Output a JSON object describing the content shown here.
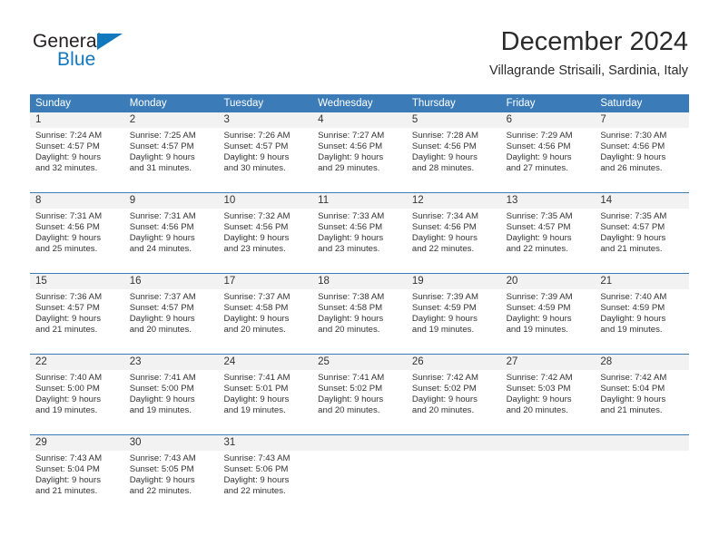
{
  "brand": {
    "name_part1": "General",
    "name_part2": "Blue",
    "triangle_icon": "blue-triangle-icon",
    "color_dark": "#231f20",
    "color_blue": "#1278be"
  },
  "header": {
    "title": "December 2024",
    "subtitle": "Villagrande Strisaili, Sardinia, Italy"
  },
  "theme": {
    "header_blue": "#3b7cb8",
    "daynum_band": "#f2f2f2",
    "text": "#333333"
  },
  "calendar": {
    "weekday_headers": [
      "Sunday",
      "Monday",
      "Tuesday",
      "Wednesday",
      "Thursday",
      "Friday",
      "Saturday"
    ],
    "weeks": [
      [
        {
          "day": "1",
          "sunrise": "Sunrise: 7:24 AM",
          "sunset": "Sunset: 4:57 PM",
          "daylight_line1": "Daylight: 9 hours",
          "daylight_line2": "and 32 minutes."
        },
        {
          "day": "2",
          "sunrise": "Sunrise: 7:25 AM",
          "sunset": "Sunset: 4:57 PM",
          "daylight_line1": "Daylight: 9 hours",
          "daylight_line2": "and 31 minutes."
        },
        {
          "day": "3",
          "sunrise": "Sunrise: 7:26 AM",
          "sunset": "Sunset: 4:57 PM",
          "daylight_line1": "Daylight: 9 hours",
          "daylight_line2": "and 30 minutes."
        },
        {
          "day": "4",
          "sunrise": "Sunrise: 7:27 AM",
          "sunset": "Sunset: 4:56 PM",
          "daylight_line1": "Daylight: 9 hours",
          "daylight_line2": "and 29 minutes."
        },
        {
          "day": "5",
          "sunrise": "Sunrise: 7:28 AM",
          "sunset": "Sunset: 4:56 PM",
          "daylight_line1": "Daylight: 9 hours",
          "daylight_line2": "and 28 minutes."
        },
        {
          "day": "6",
          "sunrise": "Sunrise: 7:29 AM",
          "sunset": "Sunset: 4:56 PM",
          "daylight_line1": "Daylight: 9 hours",
          "daylight_line2": "and 27 minutes."
        },
        {
          "day": "7",
          "sunrise": "Sunrise: 7:30 AM",
          "sunset": "Sunset: 4:56 PM",
          "daylight_line1": "Daylight: 9 hours",
          "daylight_line2": "and 26 minutes."
        }
      ],
      [
        {
          "day": "8",
          "sunrise": "Sunrise: 7:31 AM",
          "sunset": "Sunset: 4:56 PM",
          "daylight_line1": "Daylight: 9 hours",
          "daylight_line2": "and 25 minutes."
        },
        {
          "day": "9",
          "sunrise": "Sunrise: 7:31 AM",
          "sunset": "Sunset: 4:56 PM",
          "daylight_line1": "Daylight: 9 hours",
          "daylight_line2": "and 24 minutes."
        },
        {
          "day": "10",
          "sunrise": "Sunrise: 7:32 AM",
          "sunset": "Sunset: 4:56 PM",
          "daylight_line1": "Daylight: 9 hours",
          "daylight_line2": "and 23 minutes."
        },
        {
          "day": "11",
          "sunrise": "Sunrise: 7:33 AM",
          "sunset": "Sunset: 4:56 PM",
          "daylight_line1": "Daylight: 9 hours",
          "daylight_line2": "and 23 minutes."
        },
        {
          "day": "12",
          "sunrise": "Sunrise: 7:34 AM",
          "sunset": "Sunset: 4:56 PM",
          "daylight_line1": "Daylight: 9 hours",
          "daylight_line2": "and 22 minutes."
        },
        {
          "day": "13",
          "sunrise": "Sunrise: 7:35 AM",
          "sunset": "Sunset: 4:57 PM",
          "daylight_line1": "Daylight: 9 hours",
          "daylight_line2": "and 22 minutes."
        },
        {
          "day": "14",
          "sunrise": "Sunrise: 7:35 AM",
          "sunset": "Sunset: 4:57 PM",
          "daylight_line1": "Daylight: 9 hours",
          "daylight_line2": "and 21 minutes."
        }
      ],
      [
        {
          "day": "15",
          "sunrise": "Sunrise: 7:36 AM",
          "sunset": "Sunset: 4:57 PM",
          "daylight_line1": "Daylight: 9 hours",
          "daylight_line2": "and 21 minutes."
        },
        {
          "day": "16",
          "sunrise": "Sunrise: 7:37 AM",
          "sunset": "Sunset: 4:57 PM",
          "daylight_line1": "Daylight: 9 hours",
          "daylight_line2": "and 20 minutes."
        },
        {
          "day": "17",
          "sunrise": "Sunrise: 7:37 AM",
          "sunset": "Sunset: 4:58 PM",
          "daylight_line1": "Daylight: 9 hours",
          "daylight_line2": "and 20 minutes."
        },
        {
          "day": "18",
          "sunrise": "Sunrise: 7:38 AM",
          "sunset": "Sunset: 4:58 PM",
          "daylight_line1": "Daylight: 9 hours",
          "daylight_line2": "and 20 minutes."
        },
        {
          "day": "19",
          "sunrise": "Sunrise: 7:39 AM",
          "sunset": "Sunset: 4:59 PM",
          "daylight_line1": "Daylight: 9 hours",
          "daylight_line2": "and 19 minutes."
        },
        {
          "day": "20",
          "sunrise": "Sunrise: 7:39 AM",
          "sunset": "Sunset: 4:59 PM",
          "daylight_line1": "Daylight: 9 hours",
          "daylight_line2": "and 19 minutes."
        },
        {
          "day": "21",
          "sunrise": "Sunrise: 7:40 AM",
          "sunset": "Sunset: 4:59 PM",
          "daylight_line1": "Daylight: 9 hours",
          "daylight_line2": "and 19 minutes."
        }
      ],
      [
        {
          "day": "22",
          "sunrise": "Sunrise: 7:40 AM",
          "sunset": "Sunset: 5:00 PM",
          "daylight_line1": "Daylight: 9 hours",
          "daylight_line2": "and 19 minutes."
        },
        {
          "day": "23",
          "sunrise": "Sunrise: 7:41 AM",
          "sunset": "Sunset: 5:00 PM",
          "daylight_line1": "Daylight: 9 hours",
          "daylight_line2": "and 19 minutes."
        },
        {
          "day": "24",
          "sunrise": "Sunrise: 7:41 AM",
          "sunset": "Sunset: 5:01 PM",
          "daylight_line1": "Daylight: 9 hours",
          "daylight_line2": "and 19 minutes."
        },
        {
          "day": "25",
          "sunrise": "Sunrise: 7:41 AM",
          "sunset": "Sunset: 5:02 PM",
          "daylight_line1": "Daylight: 9 hours",
          "daylight_line2": "and 20 minutes."
        },
        {
          "day": "26",
          "sunrise": "Sunrise: 7:42 AM",
          "sunset": "Sunset: 5:02 PM",
          "daylight_line1": "Daylight: 9 hours",
          "daylight_line2": "and 20 minutes."
        },
        {
          "day": "27",
          "sunrise": "Sunrise: 7:42 AM",
          "sunset": "Sunset: 5:03 PM",
          "daylight_line1": "Daylight: 9 hours",
          "daylight_line2": "and 20 minutes."
        },
        {
          "day": "28",
          "sunrise": "Sunrise: 7:42 AM",
          "sunset": "Sunset: 5:04 PM",
          "daylight_line1": "Daylight: 9 hours",
          "daylight_line2": "and 21 minutes."
        }
      ],
      [
        {
          "day": "29",
          "sunrise": "Sunrise: 7:43 AM",
          "sunset": "Sunset: 5:04 PM",
          "daylight_line1": "Daylight: 9 hours",
          "daylight_line2": "and 21 minutes."
        },
        {
          "day": "30",
          "sunrise": "Sunrise: 7:43 AM",
          "sunset": "Sunset: 5:05 PM",
          "daylight_line1": "Daylight: 9 hours",
          "daylight_line2": "and 22 minutes."
        },
        {
          "day": "31",
          "sunrise": "Sunrise: 7:43 AM",
          "sunset": "Sunset: 5:06 PM",
          "daylight_line1": "Daylight: 9 hours",
          "daylight_line2": "and 22 minutes."
        },
        {
          "day": "",
          "sunrise": "",
          "sunset": "",
          "daylight_line1": "",
          "daylight_line2": ""
        },
        {
          "day": "",
          "sunrise": "",
          "sunset": "",
          "daylight_line1": "",
          "daylight_line2": ""
        },
        {
          "day": "",
          "sunrise": "",
          "sunset": "",
          "daylight_line1": "",
          "daylight_line2": ""
        },
        {
          "day": "",
          "sunrise": "",
          "sunset": "",
          "daylight_line1": "",
          "daylight_line2": ""
        }
      ]
    ]
  }
}
